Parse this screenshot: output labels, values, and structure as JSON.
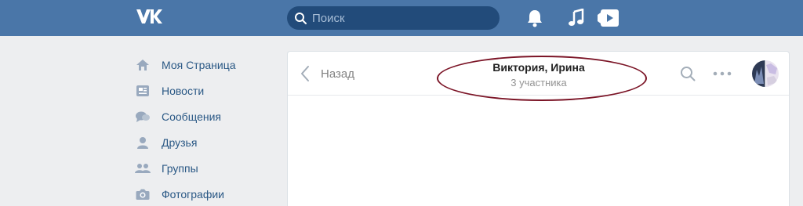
{
  "topbar": {
    "logo_text": "VK",
    "search": {
      "placeholder": "Поиск"
    },
    "icons": [
      "bell-icon",
      "music-icon",
      "video-play-icon"
    ]
  },
  "sidebar": {
    "items": [
      {
        "label": "Моя Страница",
        "icon": "home-icon"
      },
      {
        "label": "Новости",
        "icon": "news-icon"
      },
      {
        "label": "Сообщения",
        "icon": "messages-icon"
      },
      {
        "label": "Друзья",
        "icon": "friend-icon"
      },
      {
        "label": "Группы",
        "icon": "groups-icon"
      },
      {
        "label": "Фотографии",
        "icon": "camera-icon"
      }
    ]
  },
  "chat": {
    "back_label": "Назад",
    "title": "Виктория, Ирина",
    "subtitle": "3 участника"
  },
  "colors": {
    "header_bg": "#4a76a8",
    "search_bg": "#224b7a",
    "link": "#2a5885",
    "annotation": "#7b1426"
  }
}
